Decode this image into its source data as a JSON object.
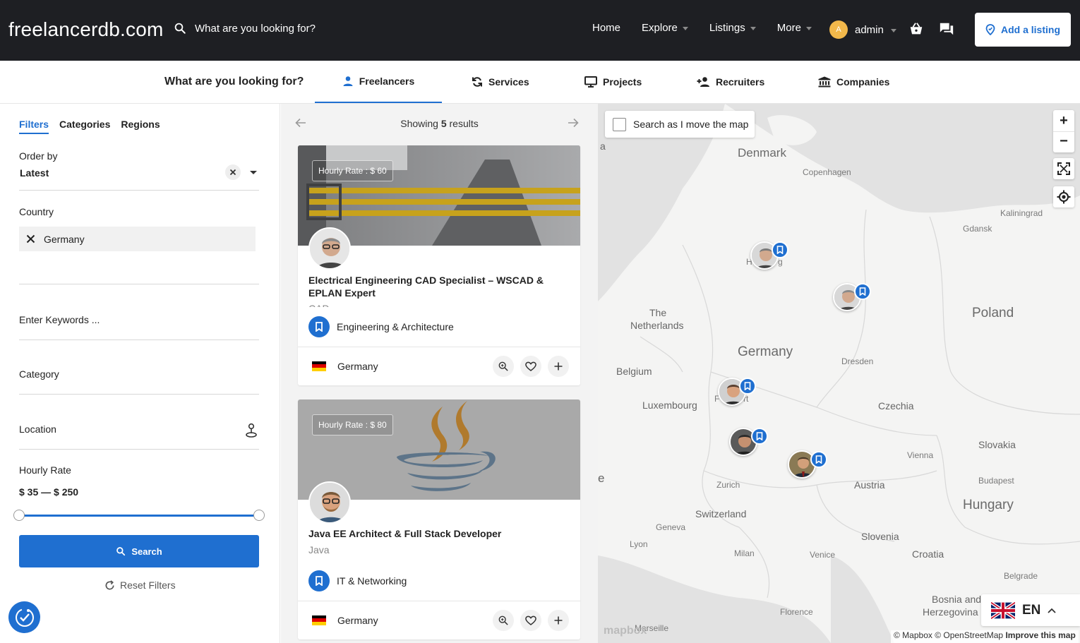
{
  "header": {
    "logo": "freelancerdb.com",
    "search_placeholder": "What are you looking for?",
    "nav": [
      {
        "label": "Home",
        "dropdown": false
      },
      {
        "label": "Explore",
        "dropdown": true
      },
      {
        "label": "Listings",
        "dropdown": true
      },
      {
        "label": "More",
        "dropdown": true
      }
    ],
    "user_initial": "A",
    "user_name": "admin",
    "add_listing": "Add a listing"
  },
  "type_tabs": {
    "title": "What are you looking for?",
    "tabs": [
      {
        "label": "Freelancers",
        "icon": "person-icon",
        "active": true
      },
      {
        "label": "Services",
        "icon": "refresh-icon",
        "active": false
      },
      {
        "label": "Projects",
        "icon": "monitor-icon",
        "active": false
      },
      {
        "label": "Recruiters",
        "icon": "person-add-icon",
        "active": false
      },
      {
        "label": "Companies",
        "icon": "bank-icon",
        "active": false
      }
    ]
  },
  "filters": {
    "tabs": [
      "Filters",
      "Categories",
      "Regions"
    ],
    "order_by_label": "Order by",
    "order_by_value": "Latest",
    "country_label": "Country",
    "country_value": "Germany",
    "keywords_placeholder": "Enter Keywords ...",
    "category_label": "Category",
    "location_label": "Location",
    "hourly_rate_label": "Hourly Rate",
    "hourly_rate_value": "$ 35 — $ 250",
    "hourly_rate_range": {
      "min": 35,
      "max": 250
    },
    "search_button": "Search",
    "reset_button": "Reset Filters"
  },
  "results": {
    "prefix": "Showing",
    "count": "5",
    "suffix": "results",
    "cards": [
      {
        "rate": "Hourly Rate : $ 60",
        "title": "Electrical Engineering CAD Specialist – WSCAD & EPLAN Expert",
        "subtitle": "CAD",
        "category": "Engineering & Architecture",
        "country": "Germany"
      },
      {
        "rate": "Hourly Rate : $ 80",
        "title": "Java EE Architect & Full Stack Developer",
        "subtitle": "Java",
        "category": "IT & Networking",
        "country": "Germany"
      }
    ]
  },
  "map": {
    "search_as_move": "Search as I move the map",
    "zoom_in": "+",
    "zoom_out": "−",
    "labels": {
      "denmark": "Denmark",
      "copenhagen": "Copenhagen",
      "kaliningrad": "Kaliningrad",
      "gdansk": "Gdansk",
      "poland": "Poland",
      "netherlands_1": "The",
      "netherlands_2": "Netherlands",
      "germany": "Germany",
      "belgium": "Belgium",
      "dresden": "Dresden",
      "luxembourg": "Luxembourg",
      "czechia": "Czechia",
      "slovakia": "Slovakia",
      "vienna": "Vienna",
      "budapest": "Budapest",
      "austria": "Austria",
      "zurich": "Zurich",
      "hungary": "Hungary",
      "switzerland": "Switzerland",
      "geneva": "Geneva",
      "lyon": "Lyon",
      "slovenia": "Slovenia",
      "milan": "Milan",
      "venice": "Venice",
      "croatia": "Croatia",
      "belgrade": "Belgrade",
      "florence": "Florence",
      "bosnia_1": "Bosnia and",
      "bosnia_2": "Herzegovina",
      "marseille": "Marseille",
      "hamburg_part1": "H",
      "hamburg_part2": "g",
      "frankfurt_part1": "F",
      "frankfurt_part2": "rt",
      "edge_a": "a",
      "edge_e": "e"
    },
    "attribution": "© Mapbox © OpenStreetMap",
    "improve": "Improve this map",
    "logo": "mapbox",
    "language": "EN"
  },
  "colors": {
    "accent": "#1f6fd0",
    "header_bg": "#1e1f23"
  }
}
